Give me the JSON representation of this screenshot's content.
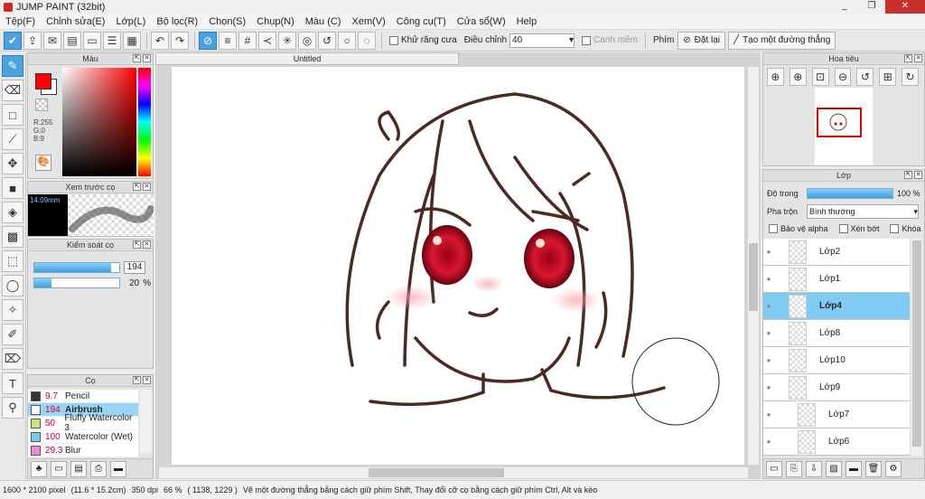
{
  "app": {
    "title": "JUMP PAINT (32bit)"
  },
  "window_controls": {
    "minimize": "_",
    "maximize": "❐",
    "close": "✕"
  },
  "menu": [
    "Tệp(F)",
    "Chỉnh sửa(E)",
    "Lớp(L)",
    "Bộ lọc(R)",
    "Chọn(S)",
    "Chụp(N)",
    "Màu (C)",
    "Xem(V)",
    "Công cụ(T)",
    "Cửa sổ(W)",
    "Help"
  ],
  "toolbar": {
    "antialias_label": "Khử răng cưa",
    "adjust_label": "Điều chỉnh",
    "adjust_value": "40",
    "edge_label": "Cạnh mềm",
    "key_label": "Phím",
    "reset_label": "Đặt lại",
    "straight_label": "Tạo một đường thẳng"
  },
  "color_panel": {
    "title": "Màu",
    "r": "R:255",
    "g": "G:0",
    "b": "B:9",
    "primary": "#ff0009",
    "secondary": "#ffffff"
  },
  "brush_preview": {
    "title": "Xem trước cọ",
    "size": "14.09mm"
  },
  "brush_control": {
    "title": "Kiểm soát cọ",
    "size_value": "194",
    "size_fraction": 0.9,
    "opacity_value": "20",
    "opacity_unit": "%",
    "opacity_fraction": 0.2
  },
  "brushes": {
    "title": "Cọ",
    "items": [
      {
        "size": "9.7",
        "name": "Pencil",
        "color": "#333333"
      },
      {
        "size": "194",
        "name": "Airbrush",
        "color": "#ffffff"
      },
      {
        "size": "50",
        "name": "Fluffy Watercolor 3",
        "color": "#c8e870"
      },
      {
        "size": "100",
        "name": "Watercolor (Wet)",
        "color": "#6cd0f0"
      },
      {
        "size": "29.3",
        "name": "Blur",
        "color": "#f08ad8"
      }
    ],
    "selected_index": 1
  },
  "document": {
    "tab_title": "Untitled"
  },
  "navigator": {
    "title": "Hoa tiêu"
  },
  "layers": {
    "title": "Lớp",
    "opacity_label": "Độ trong",
    "opacity_value": "100 %",
    "opacity_fraction": 1.0,
    "blend_label": "Pha trộn",
    "blend_value": "Bình thường",
    "protect_alpha_label": "Bảo vệ alpha",
    "clip_label": "Xén bớt",
    "lock_label": "Khóa",
    "items": [
      {
        "name": "Lớp2",
        "sub": false
      },
      {
        "name": "Lớp1",
        "sub": false
      },
      {
        "name": "Lớp4",
        "sub": false
      },
      {
        "name": "Lớp8",
        "sub": false
      },
      {
        "name": "Lớp10",
        "sub": false
      },
      {
        "name": "Lớp9",
        "sub": false
      },
      {
        "name": "Lớp7",
        "sub": true
      },
      {
        "name": "Lớp6",
        "sub": true
      }
    ],
    "selected_index": 2
  },
  "status": {
    "size": "1600 * 2100 pixel",
    "cm": "(11.6 * 15.2cm)",
    "dpi": "350 dpi",
    "zoom": "66 %",
    "coords": "( 1138, 1229 )",
    "hint": "Vẽ một đường thẳng bằng cách giữ phím Shift, Thay đổi cỡ cọ bằng cách giữ phím Ctrl, Alt và kéo"
  }
}
